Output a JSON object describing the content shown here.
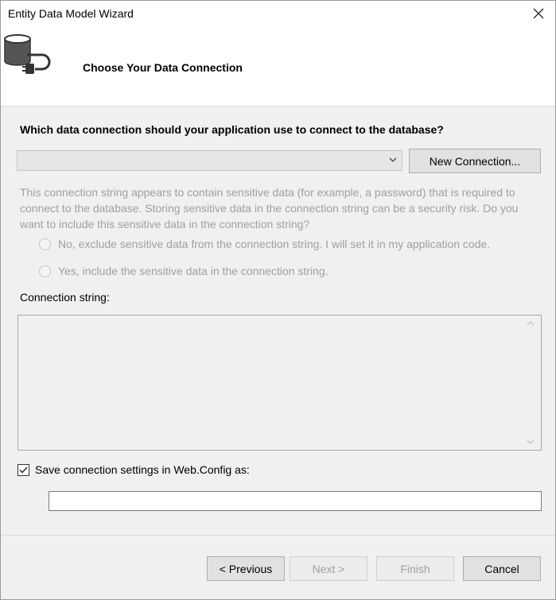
{
  "window": {
    "title": "Entity Data Model Wizard"
  },
  "header": {
    "title": "Choose Your Data Connection",
    "icon": "database-plug-icon"
  },
  "main": {
    "question": "Which data connection should your application use to connect to the database?",
    "connection_select": {
      "value": ""
    },
    "new_connection_label": "New Connection...",
    "sensitive_text": "This connection string appears to contain sensitive data (for example, a password) that is required to connect to the database. Storing sensitive data in the connection string can be a security risk. Do you want to include this sensitive data in the connection string?",
    "radio_exclude": "No, exclude sensitive data from the connection string. I will set it in my application code.",
    "radio_include": "Yes, include the sensitive data in the connection string.",
    "connection_string_label": "Connection string:",
    "connection_string_value": "",
    "save_settings_label": "Save connection settings in Web.Config as:",
    "save_settings_checked": true,
    "config_name_value": ""
  },
  "footer": {
    "previous_label": "< Previous",
    "next_label": "Next >",
    "finish_label": "Finish",
    "cancel_label": "Cancel"
  }
}
